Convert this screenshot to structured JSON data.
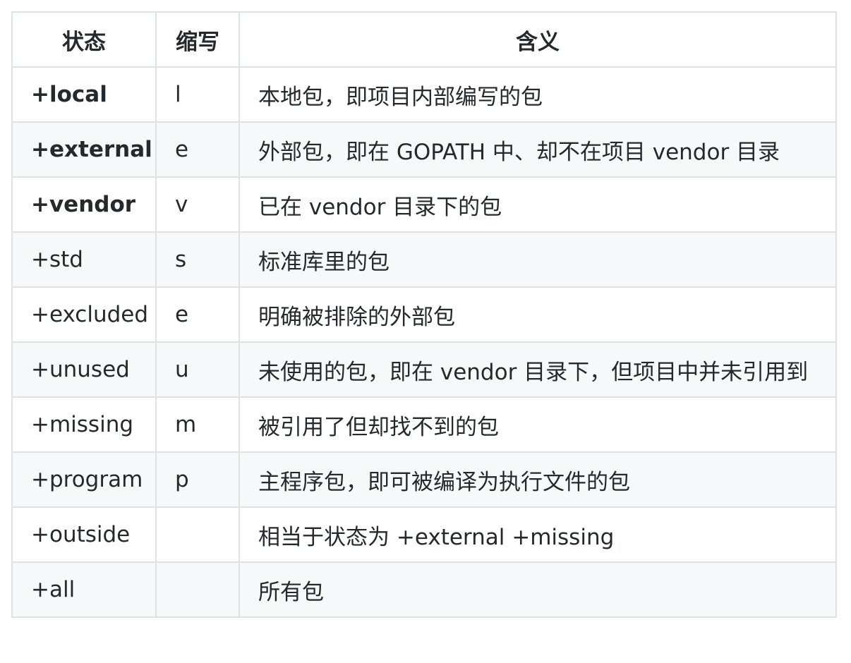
{
  "table": {
    "headers": [
      "状态",
      "缩写",
      "含义"
    ],
    "rows": [
      {
        "status": "+local",
        "abbr": "l",
        "meaning": "本地包，即项目内部编写的包",
        "bold": true
      },
      {
        "status": "+external",
        "abbr": "e",
        "meaning": "外部包，即在 GOPATH 中、却不在项目 vendor 目录",
        "bold": true
      },
      {
        "status": "+vendor",
        "abbr": "v",
        "meaning": "已在 vendor 目录下的包",
        "bold": true
      },
      {
        "status": "+std",
        "abbr": "s",
        "meaning": "标准库里的包",
        "bold": false
      },
      {
        "status": "+excluded",
        "abbr": "e",
        "meaning": "明确被排除的外部包",
        "bold": false
      },
      {
        "status": "+unused",
        "abbr": "u",
        "meaning": "未使用的包，即在 vendor 目录下，但项目中并未引用到",
        "bold": false
      },
      {
        "status": "+missing",
        "abbr": "m",
        "meaning": "被引用了但却找不到的包",
        "bold": false
      },
      {
        "status": "+program",
        "abbr": "p",
        "meaning": "主程序包，即可被编译为执行文件的包",
        "bold": false
      },
      {
        "status": "+outside",
        "abbr": "",
        "meaning": "相当于状态为 +external +missing",
        "bold": false
      },
      {
        "status": "+all",
        "abbr": "",
        "meaning": "所有包",
        "bold": false
      }
    ]
  }
}
